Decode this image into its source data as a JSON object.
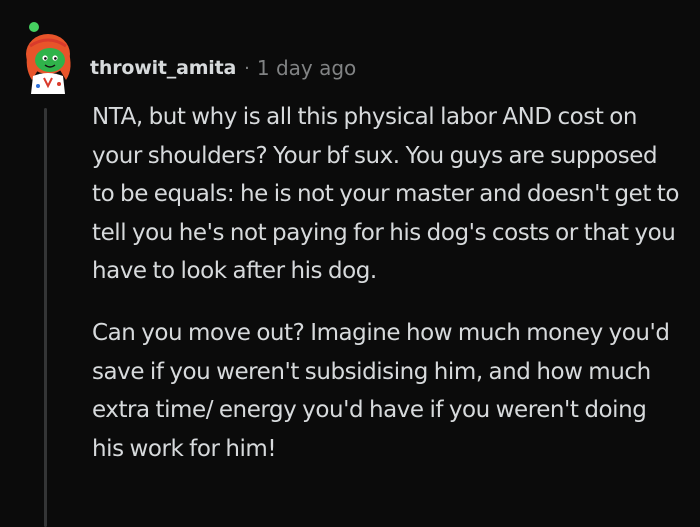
{
  "comment": {
    "author": "throwit_amita",
    "separator": "·",
    "timestamp": "1 day ago",
    "avatar": {
      "icon": "snoo-avatar-icon",
      "colors": {
        "hair": "#e8542a",
        "face": "#2fb34a",
        "shirt": "#ffffff",
        "accent": "#d93a2b",
        "status_dot": "#46d160"
      }
    },
    "paragraphs": [
      "NTA, but why is all this physical labor AND cost on your shoulders? Your bf sux. You guys are supposed to be equals: he is not your master and doesn't get to tell you he's not paying for his dog's costs or that you have to look after his dog.",
      "Can you move out? Imagine how much money you'd save if you weren't subsidising him, and how much extra time/ energy you'd have if you weren't doing his work for him!"
    ]
  },
  "colors": {
    "background": "#0b0b0b",
    "text": "#d7dadc",
    "muted": "#818384",
    "thread_line": "#343536"
  }
}
